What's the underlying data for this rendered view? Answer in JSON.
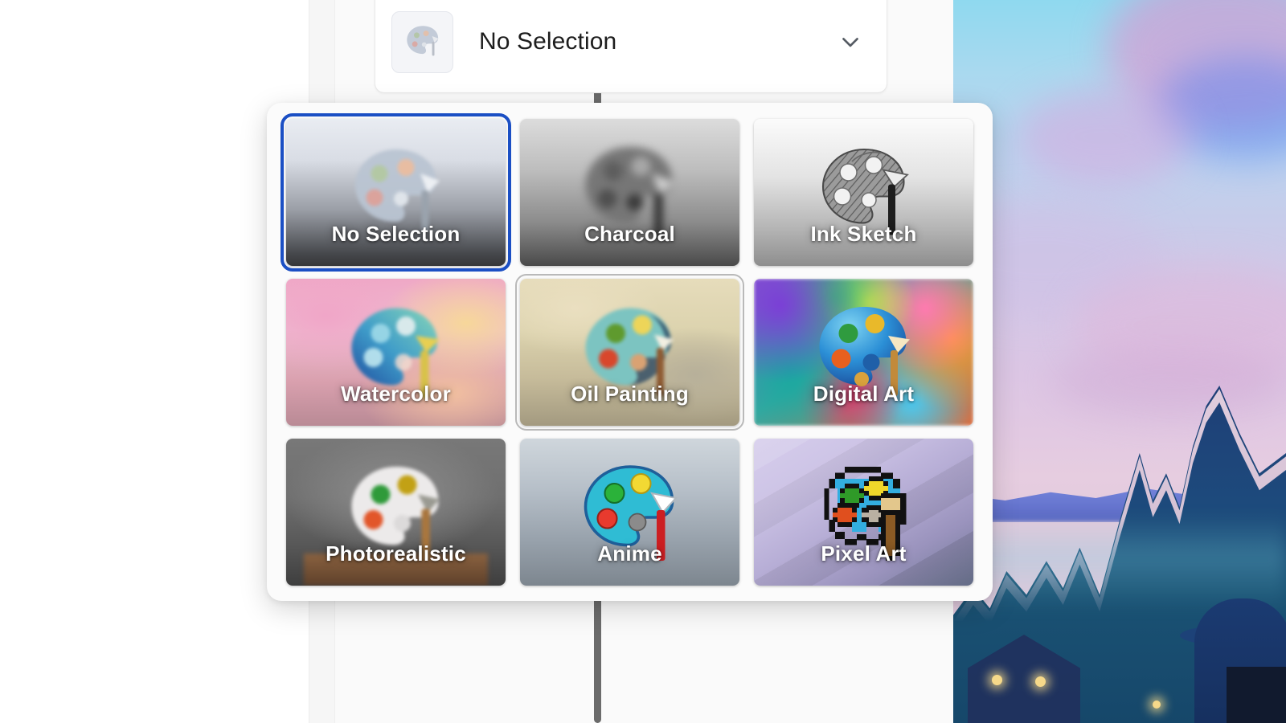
{
  "combo": {
    "name": "style-selector",
    "value": "No Selection",
    "placeholder": "No Selection",
    "thumb_icon": "palette-icon",
    "chevron_icon": "chevron-down-icon"
  },
  "dropdown": {
    "name": "style-options-dropdown",
    "columns": 3,
    "selected_index": 0,
    "hovered_index": 4,
    "accent_selected": "#1b4fc4",
    "accent_hover": "#b9b9b9",
    "options": [
      {
        "label": "No Selection",
        "icon": "palette-icon",
        "state": "selected"
      },
      {
        "label": "Charcoal",
        "icon": "palette-icon",
        "state": "normal"
      },
      {
        "label": "Ink Sketch",
        "icon": "palette-icon",
        "state": "normal"
      },
      {
        "label": "Watercolor",
        "icon": "palette-icon",
        "state": "normal"
      },
      {
        "label": "Oil Painting",
        "icon": "palette-icon",
        "state": "hovered"
      },
      {
        "label": "Digital Art",
        "icon": "palette-icon",
        "state": "normal"
      },
      {
        "label": "Photorealistic",
        "icon": "palette-icon",
        "state": "normal"
      },
      {
        "label": "Anime",
        "icon": "palette-icon",
        "state": "normal"
      },
      {
        "label": "Pixel Art",
        "icon": "palette-icon",
        "state": "normal"
      }
    ]
  },
  "artwork": {
    "name": "preview-artwork",
    "description": "Pastel sky over dark blue mountain village"
  },
  "scrollbar": {
    "name": "panel-scrollbar"
  }
}
